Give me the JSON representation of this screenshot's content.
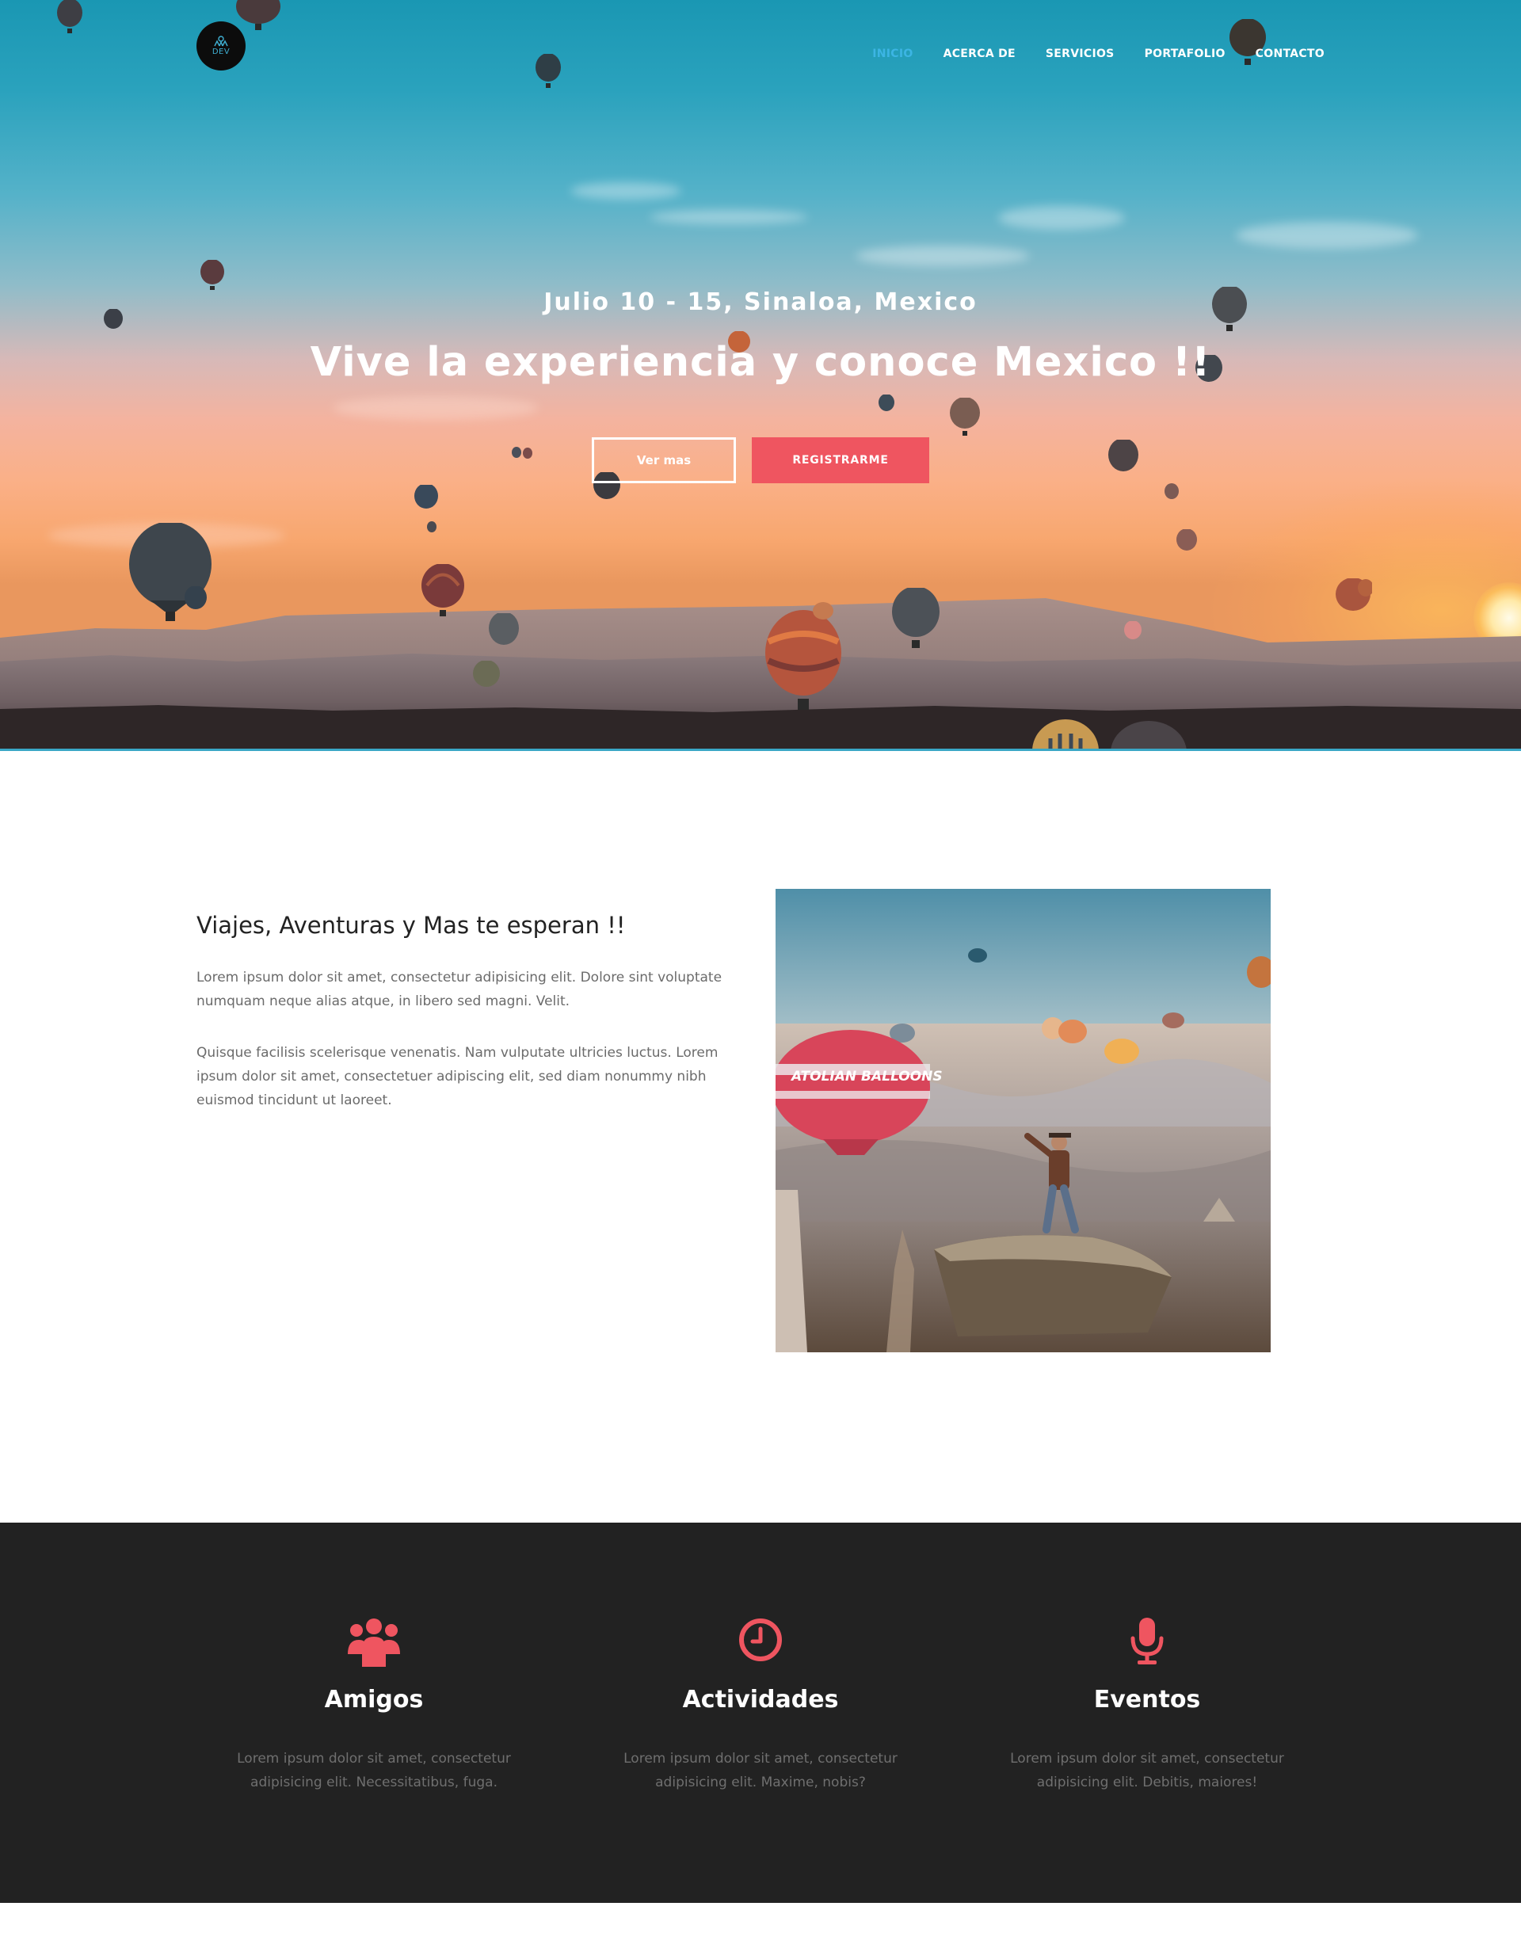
{
  "brand": {
    "logo_text": "DEV"
  },
  "nav": {
    "items": [
      {
        "label": "INICIO",
        "active": true
      },
      {
        "label": "ACERCA DE"
      },
      {
        "label": "SERVICIOS"
      },
      {
        "label": "PORTAFOLIO"
      },
      {
        "label": "CONTACTO"
      }
    ]
  },
  "hero": {
    "subtitle": "Julio 10 - 15, Sinaloa, Mexico",
    "title": "Vive la experiencia y conoce Mexico !!",
    "primary_button": "Ver mas",
    "secondary_button": "REGISTRARME"
  },
  "about": {
    "title": "Viajes, Aventuras y Mas te esperan !!",
    "paragraph1": "Lorem ipsum dolor sit amet, consectetur adipisicing elit. Dolore sint voluptate numquam neque alias atque, in libero sed magni. Velit.",
    "paragraph2": "Quisque facilisis scelerisque venenatis. Nam vulputate ultricies luctus. Lorem ipsum dolor sit amet, consectetuer adipiscing elit, sed diam nonummy nibh euismod tincidunt ut laoreet.",
    "photo_label": "ATOLIAN BALLOONS"
  },
  "features": [
    {
      "icon": "users-icon",
      "title": "Amigos",
      "text": "Lorem ipsum dolor sit amet, consectetur adipisicing elit. Necessitatibus, fuga."
    },
    {
      "icon": "clock-icon",
      "title": "Actividades",
      "text": "Lorem ipsum dolor sit amet, consectetur adipisicing elit. Maxime, nobis?"
    },
    {
      "icon": "microphone-icon",
      "title": "Eventos",
      "text": "Lorem ipsum dolor sit amet, consectetur adipisicing elit. Debitis, maiores!"
    }
  ],
  "colors": {
    "accent": "#ef5560",
    "nav_active": "#3cb5e4",
    "dark_section": "#222222",
    "text_muted": "#6b6b6b"
  }
}
